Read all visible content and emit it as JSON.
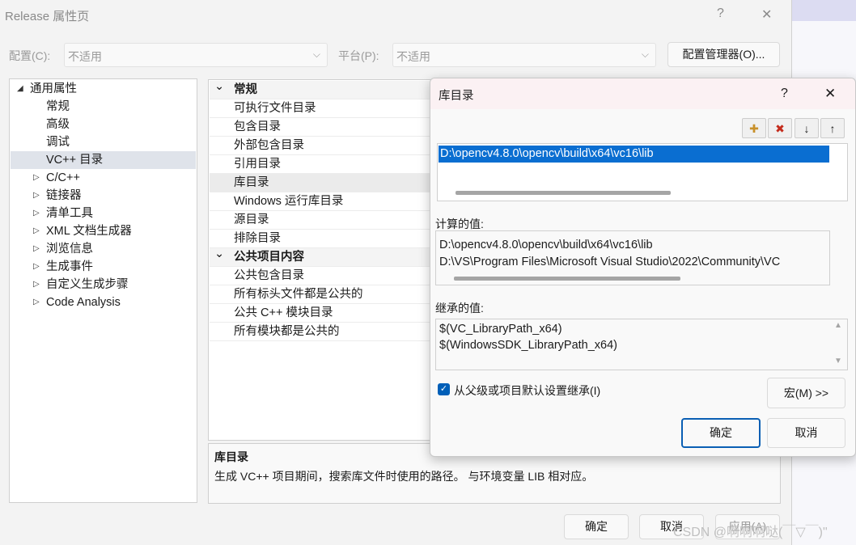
{
  "window": {
    "title": "Release 属性页",
    "help": "?",
    "close": "✕",
    "config_label": "配置(C):",
    "config_value": "不适用",
    "platform_label": "平台(P):",
    "platform_value": "不适用",
    "config_manager": "配置管理器(O)...",
    "ok": "确定",
    "cancel": "取消",
    "apply": "应用(A)"
  },
  "tree": [
    {
      "label": "通用属性",
      "expand": "◢"
    },
    {
      "label": "常规"
    },
    {
      "label": "高级"
    },
    {
      "label": "调试"
    },
    {
      "label": "VC++ 目录"
    },
    {
      "label": "C/C++",
      "expand": "▷"
    },
    {
      "label": "链接器",
      "expand": "▷"
    },
    {
      "label": "清单工具",
      "expand": "▷"
    },
    {
      "label": "XML 文档生成器",
      "expand": "▷"
    },
    {
      "label": "浏览信息",
      "expand": "▷"
    },
    {
      "label": "生成事件",
      "expand": "▷"
    },
    {
      "label": "自定义生成步骤",
      "expand": "▷"
    },
    {
      "label": "Code Analysis",
      "expand": "▷"
    }
  ],
  "grid": {
    "section1": "常规",
    "section2": "公共项目内容",
    "collapse": "⌄",
    "rows1": [
      "可执行文件目录",
      "包含目录",
      "外部包含目录",
      "引用目录",
      "库目录",
      "Windows 运行库目录",
      "源目录",
      "排除目录"
    ],
    "rows2": [
      "公共包含目录",
      "所有标头文件都是公共的",
      "公共 C++ 模块目录",
      "所有模块都是公共的"
    ]
  },
  "description": {
    "title": "库目录",
    "text": "生成 VC++ 项目期间，搜索库文件时使用的路径。 与环境变量 LIB 相对应。"
  },
  "dialog": {
    "title": "库目录",
    "help": "?",
    "close": "✕",
    "edit_entry": "D:\\opencv4.8.0\\opencv\\build\\x64\\vc16\\lib",
    "computed_label": "计算的值:",
    "computed": [
      "D:\\opencv4.8.0\\opencv\\build\\x64\\vc16\\lib",
      "D:\\VS\\Program Files\\Microsoft Visual Studio\\2022\\Community\\VC"
    ],
    "inherited_label": "继承的值:",
    "inherited": [
      "$(VC_LibraryPath_x64)",
      "$(WindowsSDK_LibraryPath_x64)"
    ],
    "inherit_checkbox": "从父级或项目默认设置继承(I)",
    "macros": "宏(M) >>",
    "ok": "确定",
    "cancel": "取消",
    "tools": {
      "new": "✚",
      "delete": "✖",
      "down": "↓",
      "up": "↑"
    },
    "scroll_up": "▲",
    "scroll_down": "▼",
    "check": "✓"
  },
  "watermark": "CSDN @啊啊啊哒(￣▽￣)\""
}
